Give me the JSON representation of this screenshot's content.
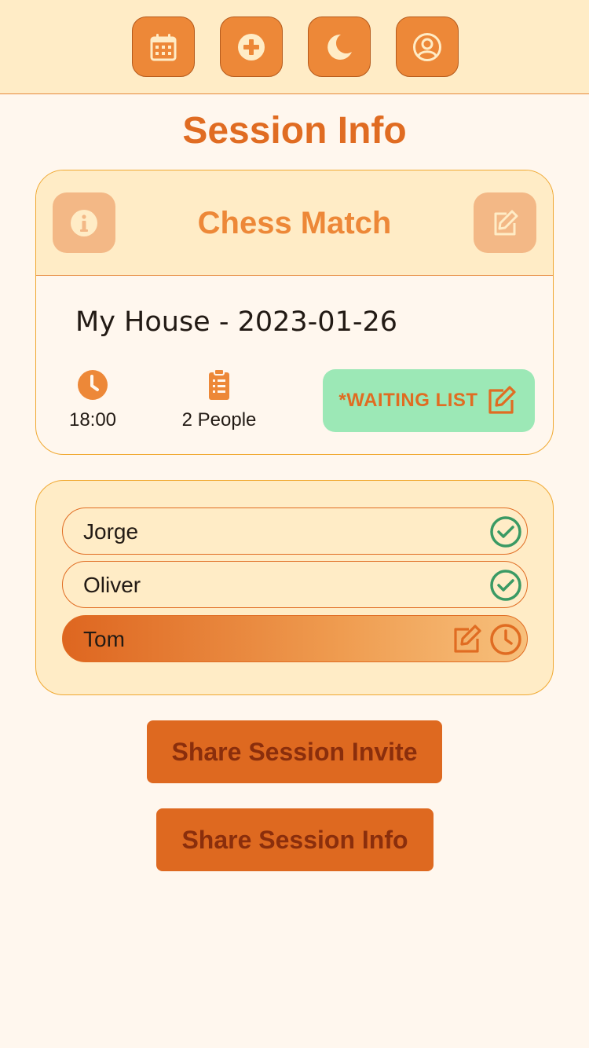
{
  "nav": {
    "items": [
      {
        "icon": "calendar-icon"
      },
      {
        "icon": "plus-circle-icon"
      },
      {
        "icon": "moon-icon"
      },
      {
        "icon": "user-circle-icon"
      }
    ]
  },
  "page": {
    "title": "Session Info"
  },
  "session": {
    "name": "Chess Match",
    "location_date": "My House - 2023-01-26",
    "time": "18:00",
    "people": "2 People",
    "waiting_list_label": "*WAITING LIST"
  },
  "attendees": [
    {
      "name": "Jorge",
      "status": "confirmed"
    },
    {
      "name": "Oliver",
      "status": "confirmed"
    },
    {
      "name": "Tom",
      "status": "pending"
    }
  ],
  "actions": {
    "share_invite": "Share Session Invite",
    "share_info": "Share Session Info"
  },
  "colors": {
    "accent": "#ed8838",
    "accent_dark": "#e06c22",
    "header_bg": "#ffecc6",
    "page_bg": "#fff7ee",
    "waiting_bg": "#9ce8b6",
    "confirmed_green": "#3a9a64"
  }
}
